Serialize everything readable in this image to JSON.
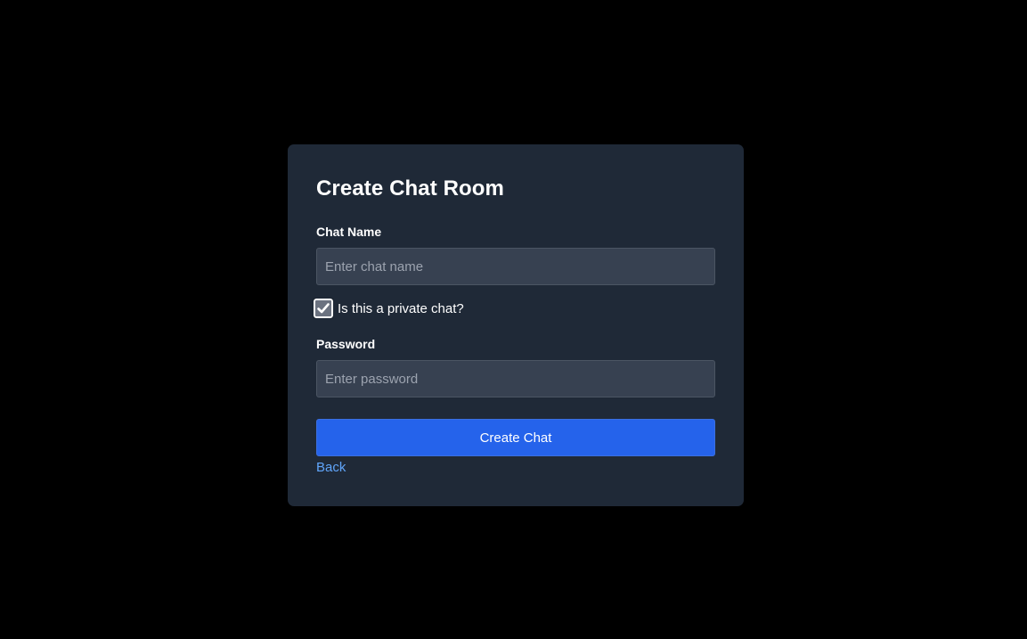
{
  "form": {
    "title": "Create Chat Room",
    "chat_name_label": "Chat Name",
    "chat_name_placeholder": "Enter chat name",
    "chat_name_value": "",
    "private_checkbox_label": "Is this a private chat?",
    "private_checked": true,
    "password_label": "Password",
    "password_placeholder": "Enter password",
    "password_value": "",
    "submit_label": "Create Chat",
    "back_label": "Back"
  },
  "colors": {
    "page_background": "#000000",
    "card_background": "#1f2937",
    "input_background": "#374151",
    "primary_button": "#2563eb",
    "link": "#60a5fa"
  },
  "icons": {
    "checkbox": "checkmark-icon"
  }
}
